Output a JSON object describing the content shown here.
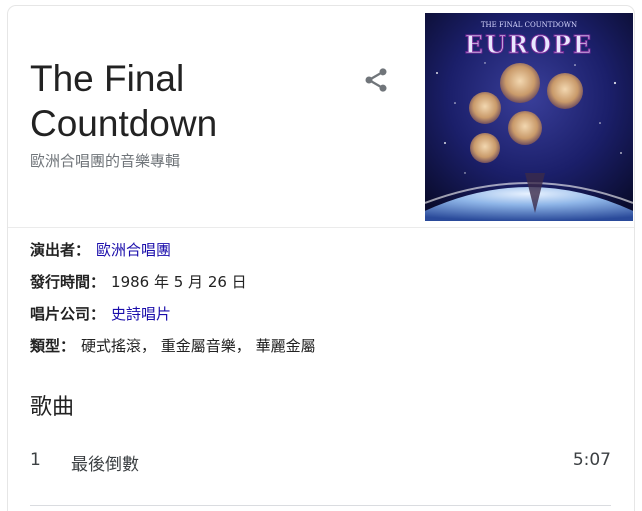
{
  "header": {
    "title_line1": "The Final",
    "title_line2": "Countdown",
    "subtitle": "歐洲合唱團的音樂專輯"
  },
  "share_icon": "share-icon",
  "cover": {
    "small_text": "THE FINAL COUNTDOWN",
    "logo_text": "EUROPE"
  },
  "facts": [
    {
      "key": "演出者",
      "sep": "：",
      "value": "歐洲合唱團",
      "is_link": true
    },
    {
      "key": "發行時間",
      "sep": "：",
      "value": "1986 年 5 月 26 日",
      "is_link": false
    },
    {
      "key": "唱片公司",
      "sep": "：",
      "value": "史詩唱片",
      "is_link": true
    },
    {
      "key": "類型",
      "sep": "：",
      "value": "硬式搖滾， 重金屬音樂， 華麗金屬",
      "is_link": false
    }
  ],
  "songs": {
    "heading": "歌曲",
    "tracks": [
      {
        "number": "1",
        "name": "最後倒數",
        "duration": "5:07"
      }
    ]
  }
}
